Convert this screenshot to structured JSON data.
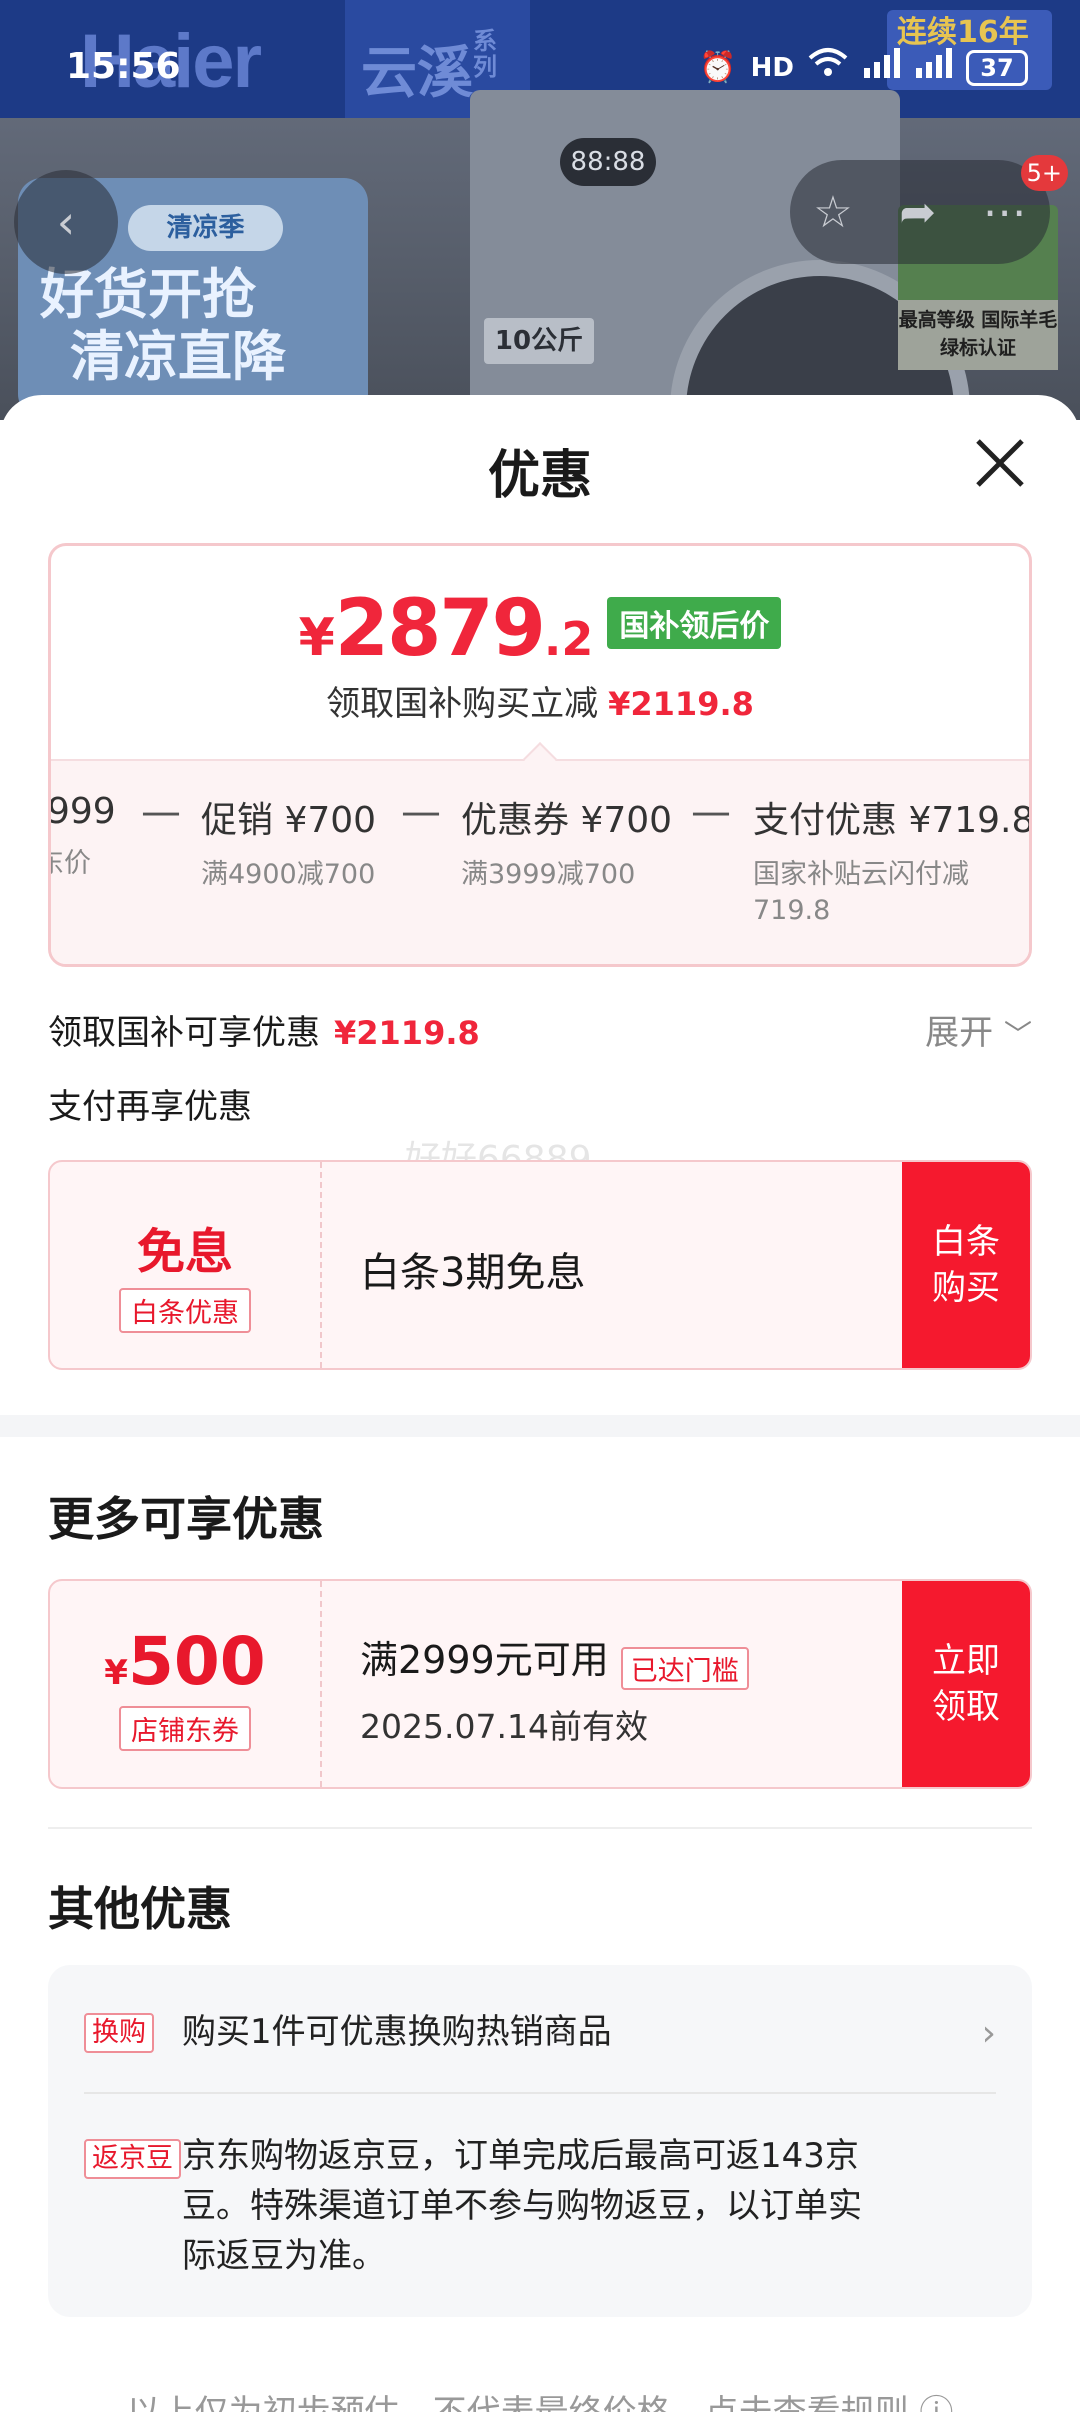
{
  "status_bar": {
    "time": "15:56",
    "icons": [
      "alarm-icon",
      "hd-icon",
      "wifi-icon",
      "5g-signal-icon",
      "5g-signal-icon",
      "battery-icon"
    ],
    "battery": "37"
  },
  "background": {
    "brand": "Haier",
    "series": "云溪",
    "series_suffix": "系列",
    "corner_badge": "连续16年",
    "promo_tag": "清凉季",
    "promo_line1": "好货开抢",
    "promo_line2": "清凉直降",
    "machine_display": "88:88",
    "capacity": "10公斤",
    "wool_cert": "最高等级 国际羊毛绿标认证",
    "cart_count": "5+"
  },
  "sheet": {
    "title": "优惠"
  },
  "price_card": {
    "symbol": "¥",
    "price_int": "2879",
    "price_dec": ".2",
    "price_tag": "国补领后价",
    "subtitle": "领取国补购买立减",
    "subtitle_amount": "¥2119.8",
    "breakdown": [
      {
        "label": "999",
        "desc": "东价"
      },
      {
        "label": "促销 ¥700",
        "desc": "满4900减700"
      },
      {
        "label": "优惠券 ¥700",
        "desc": "满3999减700"
      },
      {
        "label": "支付优惠 ¥719.8",
        "desc": "国家补贴云闪付减",
        "desc2": "719.8"
      }
    ],
    "minus": "—"
  },
  "subsidy_row": {
    "label": "领取国补可享优惠",
    "amount": "¥2119.8",
    "expand": "展开"
  },
  "pay_section": {
    "label": "支付再享优惠",
    "watermark": "好好66889",
    "coupon": {
      "badge": "免息",
      "tag": "白条优惠",
      "desc": "白条3期免息",
      "action_line1": "白条",
      "action_line2": "购买"
    }
  },
  "more_section": {
    "title": "更多可享优惠",
    "coupon": {
      "yuan": "¥",
      "amount": "500",
      "tag": "店铺东券",
      "condition": "满2999元可用",
      "reached": "已达门槛",
      "valid": "2025.07.14前有效",
      "action_line1": "立即",
      "action_line2": "领取"
    }
  },
  "other_section": {
    "title": "其他优惠",
    "items": [
      {
        "tag": "换购",
        "text": "购买1件可优惠换购热销商品"
      },
      {
        "tag": "返京豆",
        "line1": "京东购物返京豆，订单完成后最高可返143京",
        "line2": "豆。特殊渠道订单不参与购物返豆，以订单实",
        "line3": "际返豆为准。"
      }
    ]
  },
  "footer": {
    "note": "以上仅为初步预估，不代表最终价格，点击查看规则 ⓘ"
  },
  "colors": {
    "accent_red": "#f0263b",
    "action_red": "#f5192e",
    "subsidy_green": "#3fab4b"
  }
}
